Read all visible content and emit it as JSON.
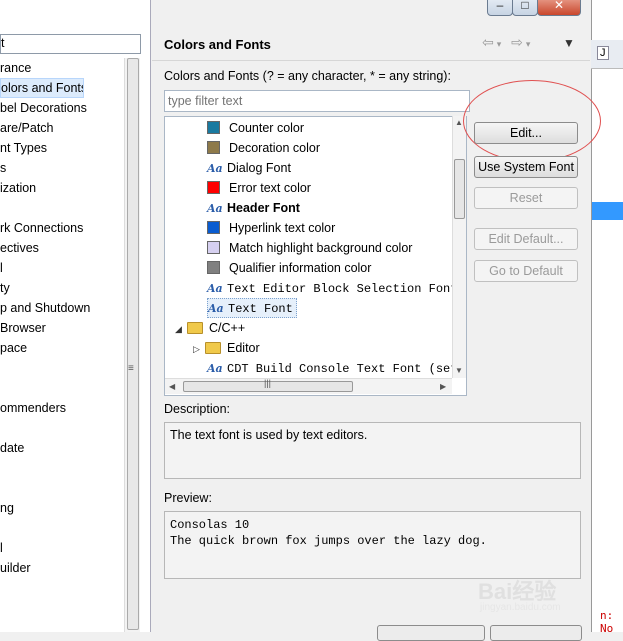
{
  "left_nav": {
    "items": [
      {
        "label": "rance"
      },
      {
        "label": "olors and Fonts",
        "selected": true
      },
      {
        "label": "bel Decorations"
      },
      {
        "label": "are/Patch"
      },
      {
        "label": "nt Types"
      },
      {
        "label": "s"
      },
      {
        "label": "ization"
      },
      {
        "label": ""
      },
      {
        "label": "rk Connections"
      },
      {
        "label": "ectives"
      },
      {
        "label": "l"
      },
      {
        "label": "ty"
      },
      {
        "label": "p and Shutdown"
      },
      {
        "label": "Browser"
      },
      {
        "label": "pace"
      },
      {
        "label": ""
      },
      {
        "label": ""
      },
      {
        "label": "ommenders"
      },
      {
        "label": ""
      },
      {
        "label": "date"
      },
      {
        "label": ""
      },
      {
        "label": ""
      },
      {
        "label": "ng"
      },
      {
        "label": ""
      },
      {
        "label": "l"
      },
      {
        "label": "uilder"
      }
    ]
  },
  "header": {
    "title": "Colors and Fonts",
    "back_icon": "back-arrow-icon",
    "forward_icon": "forward-arrow-icon"
  },
  "filter": {
    "caption": "Colors and Fonts (? = any character, * = any string):",
    "placeholder": "type filter text"
  },
  "tree": {
    "items": [
      {
        "label": "Counter color",
        "kind": "color",
        "color": "#1a7aa0"
      },
      {
        "label": "Decoration color",
        "kind": "color",
        "color": "#8e7a4a"
      },
      {
        "label": "Dialog Font",
        "kind": "font"
      },
      {
        "label": "Error text color",
        "kind": "color",
        "color": "#ff0000"
      },
      {
        "label": "Header Font",
        "kind": "font",
        "bold": true
      },
      {
        "label": "Hyperlink text color",
        "kind": "color",
        "color": "#0a5cd0"
      },
      {
        "label": "Match highlight background color",
        "kind": "color",
        "color": "#d6d0f0"
      },
      {
        "label": "Qualifier information color",
        "kind": "color",
        "color": "#808080"
      },
      {
        "label": "Text Editor Block Selection Font",
        "kind": "font",
        "mono": true
      },
      {
        "label": "Text Font",
        "kind": "font",
        "mono": true,
        "selected": true
      },
      {
        "label": "C/C++",
        "kind": "category",
        "expanded": true
      },
      {
        "label": "Editor",
        "kind": "category",
        "expanded": false
      },
      {
        "label": "CDT Build Console Text Font (set",
        "kind": "font",
        "mono": true
      }
    ]
  },
  "buttons": {
    "edit": "Edit...",
    "use_system_font": "Use System Font",
    "reset": "Reset",
    "edit_default": "Edit Default...",
    "go_to_default": "Go to Default"
  },
  "description": {
    "caption": "Description:",
    "text": "The text font is used by text editors."
  },
  "preview": {
    "caption": "Preview:",
    "line1": "Consolas 10",
    "line2": "The quick brown fox jumps over the lazy dog."
  },
  "background_window": {
    "toolbar_label": "J",
    "red_text": "n: No"
  },
  "watermark": {
    "text": "Bai经验",
    "sub": "jingyan.baidu.com"
  }
}
